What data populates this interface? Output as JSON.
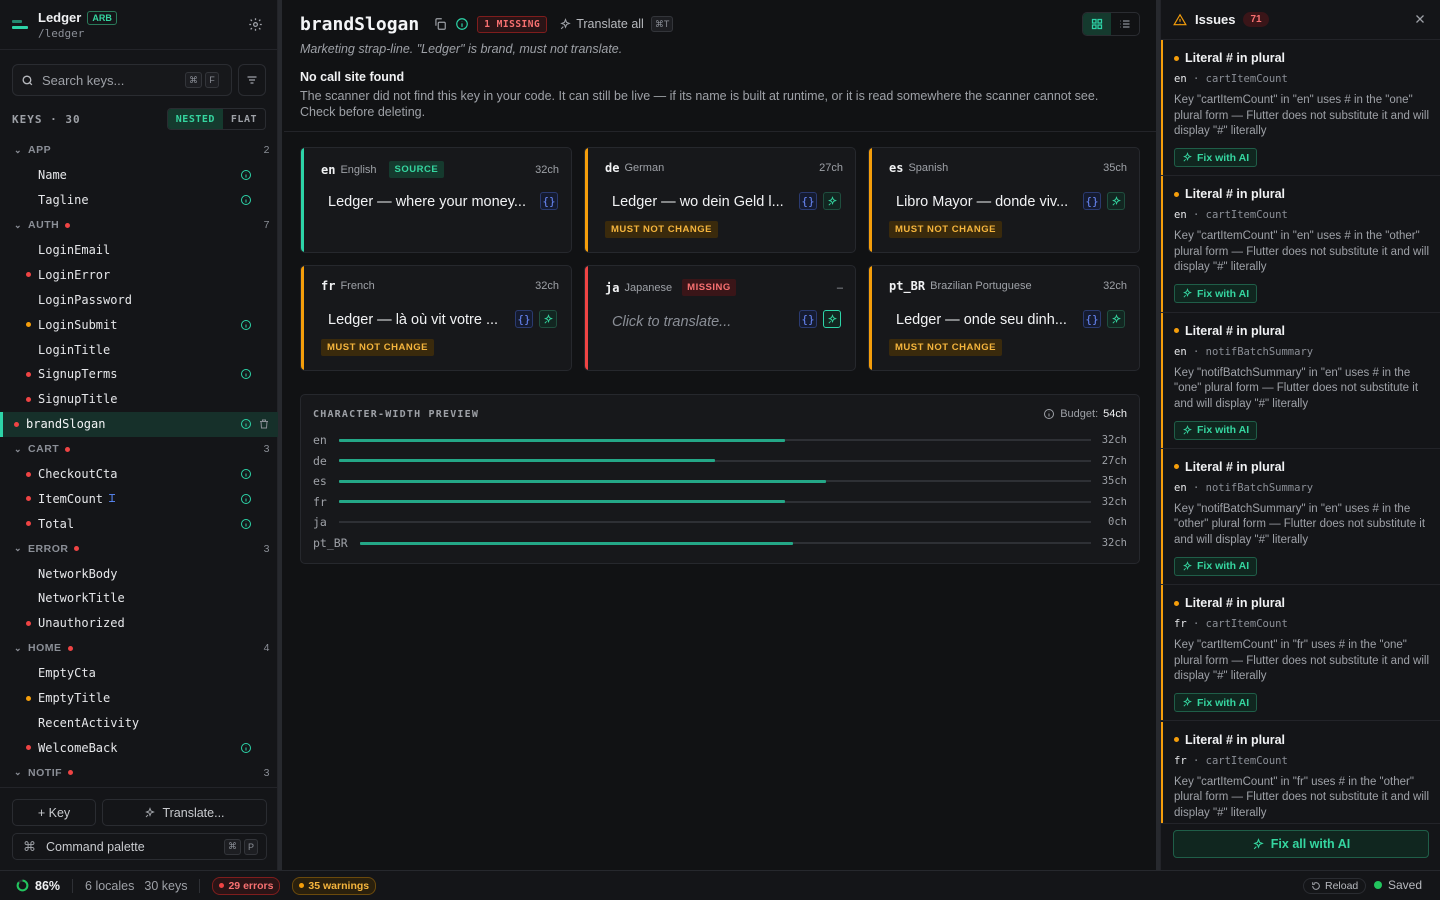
{
  "app": {
    "title": "Ledger",
    "format_badge": "ARB",
    "path": "/ledger"
  },
  "sidebar": {
    "search_placeholder": "Search keys...",
    "search_shortcut": [
      "⌘",
      "F"
    ],
    "keys_label": "KEYS · 30",
    "view_modes": [
      "NESTED",
      "FLAT"
    ],
    "tree": [
      {
        "type": "group",
        "label": "APP",
        "count": "2",
        "error": false
      },
      {
        "type": "leaf",
        "label": "Name",
        "dot": "none",
        "info": true
      },
      {
        "type": "leaf",
        "label": "Tagline",
        "dot": "none",
        "info": true
      },
      {
        "type": "group",
        "label": "AUTH",
        "count": "7",
        "error": true
      },
      {
        "type": "leaf",
        "label": "LoginEmail",
        "dot": "none",
        "info": false
      },
      {
        "type": "leaf",
        "label": "LoginError",
        "dot": "red",
        "info": false
      },
      {
        "type": "leaf",
        "label": "LoginPassword",
        "dot": "none",
        "info": false
      },
      {
        "type": "leaf",
        "label": "LoginSubmit",
        "dot": "amber",
        "info": true
      },
      {
        "type": "leaf",
        "label": "LoginTitle",
        "dot": "none",
        "info": false
      },
      {
        "type": "leaf",
        "label": "SignupTerms",
        "dot": "red",
        "info": true
      },
      {
        "type": "leaf",
        "label": "SignupTitle",
        "dot": "red",
        "info": false
      },
      {
        "type": "leaf",
        "label": "brandSlogan",
        "dot": "red",
        "info": true,
        "selected": true
      },
      {
        "type": "group",
        "label": "CART",
        "count": "3",
        "error": true
      },
      {
        "type": "leaf",
        "label": "CheckoutCta",
        "dot": "red",
        "info": true
      },
      {
        "type": "leaf",
        "label": "ItemCount",
        "dot": "red",
        "info": true,
        "plural": true
      },
      {
        "type": "leaf",
        "label": "Total",
        "dot": "red",
        "info": true
      },
      {
        "type": "group",
        "label": "ERROR",
        "count": "3",
        "error": true
      },
      {
        "type": "leaf",
        "label": "NetworkBody",
        "dot": "none",
        "info": false
      },
      {
        "type": "leaf",
        "label": "NetworkTitle",
        "dot": "none",
        "info": false
      },
      {
        "type": "leaf",
        "label": "Unauthorized",
        "dot": "red",
        "info": false
      },
      {
        "type": "group",
        "label": "HOME",
        "count": "4",
        "error": true
      },
      {
        "type": "leaf",
        "label": "EmptyCta",
        "dot": "none",
        "info": false
      },
      {
        "type": "leaf",
        "label": "EmptyTitle",
        "dot": "amber",
        "info": false
      },
      {
        "type": "leaf",
        "label": "RecentActivity",
        "dot": "none",
        "info": false
      },
      {
        "type": "leaf",
        "label": "WelcomeBack",
        "dot": "red",
        "info": true
      },
      {
        "type": "group",
        "label": "NOTIF",
        "count": "3",
        "error": true
      }
    ],
    "add_key_label": "+ Key",
    "translate_label": "Translate...",
    "command_palette_label": "Command palette",
    "command_shortcut": [
      "⌘",
      "P"
    ]
  },
  "editor": {
    "key": "brandSlogan",
    "missing_badge": "1 MISSING",
    "translate_all_label": "Translate all",
    "translate_all_shortcut": "⌘T",
    "description": "Marketing strap-line. \"Ledger\" is brand, must not translate.",
    "warning_title": "No call site found",
    "warning_body": "The scanner did not find this key in your code. It can still be live — if its name is built at runtime, or it is read somewhere the scanner cannot see. Check before deleting.",
    "source_badge": "SOURCE",
    "missing_label": "MISSING",
    "must_not_change": "MUST NOT CHANGE",
    "locales": [
      {
        "code": "en",
        "name": "English",
        "chars": "32ch",
        "value": "Ledger — where your money...",
        "status": "source"
      },
      {
        "code": "de",
        "name": "German",
        "chars": "27ch",
        "value": "Ledger — wo dein Geld l...",
        "status": "warn"
      },
      {
        "code": "es",
        "name": "Spanish",
        "chars": "35ch",
        "value": "Libro Mayor — donde viv...",
        "status": "warn"
      },
      {
        "code": "fr",
        "name": "French",
        "chars": "32ch",
        "value": "Ledger — là où vit votre ...",
        "status": "warn"
      },
      {
        "code": "ja",
        "name": "Japanese",
        "chars": "–",
        "value": "Click to translate...",
        "status": "missing"
      },
      {
        "code": "pt_BR",
        "name": "Brazilian Portuguese",
        "chars": "32ch",
        "value": "Ledger — onde seu dinh...",
        "status": "warn"
      }
    ]
  },
  "preview": {
    "title": "CHARACTER-WIDTH PREVIEW",
    "budget_label": "Budget:",
    "budget_value": "54ch",
    "budget_chars": 54,
    "rows": [
      {
        "locale": "en",
        "chars": 32,
        "label": "32ch"
      },
      {
        "locale": "de",
        "chars": 27,
        "label": "27ch"
      },
      {
        "locale": "es",
        "chars": 35,
        "label": "35ch"
      },
      {
        "locale": "fr",
        "chars": 32,
        "label": "32ch"
      },
      {
        "locale": "ja",
        "chars": 0,
        "label": "0ch"
      },
      {
        "locale": "pt_BR",
        "chars": 32,
        "label": "32ch"
      }
    ]
  },
  "issues_panel": {
    "title": "Issues",
    "count": "71",
    "fix_label": "Fix with AI",
    "fix_all_label": "Fix all with AI",
    "items": [
      {
        "title": "Literal # in plural",
        "locale": "en",
        "key": "cartItemCount",
        "body": "Key \"cartItemCount\" in \"en\" uses # in the \"one\" plural form — Flutter does not substitute it and will display \"#\" literally"
      },
      {
        "title": "Literal # in plural",
        "locale": "en",
        "key": "cartItemCount",
        "body": "Key \"cartItemCount\" in \"en\" uses # in the \"other\" plural form — Flutter does not substitute it and will display \"#\" literally"
      },
      {
        "title": "Literal # in plural",
        "locale": "en",
        "key": "notifBatchSummary",
        "body": "Key \"notifBatchSummary\" in \"en\" uses # in the \"one\" plural form — Flutter does not substitute it and will display \"#\" literally"
      },
      {
        "title": "Literal # in plural",
        "locale": "en",
        "key": "notifBatchSummary",
        "body": "Key \"notifBatchSummary\" in \"en\" uses # in the \"other\" plural form — Flutter does not substitute it and will display \"#\" literally"
      },
      {
        "title": "Literal # in plural",
        "locale": "fr",
        "key": "cartItemCount",
        "body": "Key \"cartItemCount\" in \"fr\" uses # in the \"one\" plural form — Flutter does not substitute it and will display \"#\" literally"
      },
      {
        "title": "Literal # in plural",
        "locale": "fr",
        "key": "cartItemCount",
        "body": "Key \"cartItemCount\" in \"fr\" uses # in the \"other\" plural form — Flutter does not substitute it and will display \"#\" literally"
      }
    ]
  },
  "statusbar": {
    "coverage": "86%",
    "coverage_value": 0.86,
    "locales": "6 locales",
    "keys": "30 keys",
    "errors": "29 errors",
    "warnings": "35 warnings",
    "reload_label": "Reload",
    "saved_label": "Saved"
  },
  "colors": {
    "accent": "#2dd4a8",
    "error": "#ef4444",
    "warning": "#f59e0b",
    "background": "#111214"
  }
}
